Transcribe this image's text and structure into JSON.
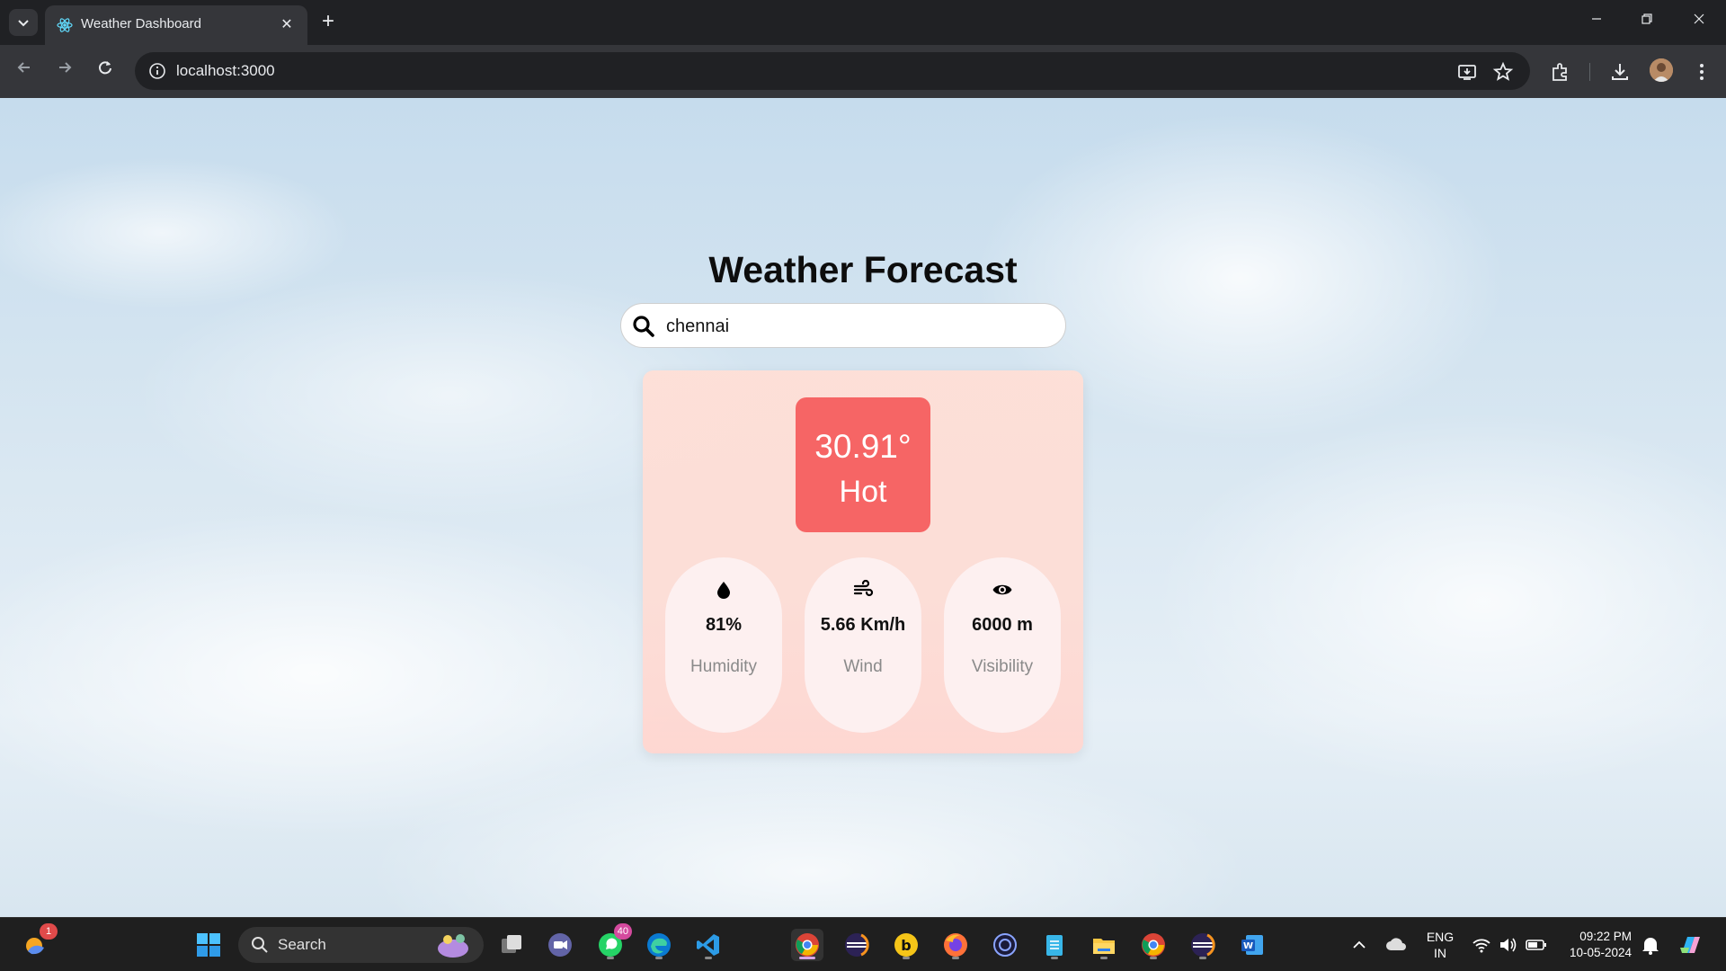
{
  "browser": {
    "tab_title": "Weather Dashboard",
    "tab_close": "✕",
    "new_tab": "+",
    "url": "localhost:3000"
  },
  "page": {
    "title": "Weather Forecast",
    "search": {
      "value": "chennai"
    },
    "weather": {
      "temperature": "30.91°",
      "condition": "Hot",
      "humidity": {
        "value": "81%",
        "label": "Humidity"
      },
      "wind": {
        "value": "5.66 Km/h",
        "label": "Wind"
      },
      "visibility": {
        "value": "6000 m",
        "label": "Visibility"
      }
    }
  },
  "taskbar": {
    "search_label": "Search",
    "notification_count": "1",
    "whatsapp_badge": "40",
    "language": "ENG",
    "region": "IN",
    "time": "09:22 PM",
    "date": "10-05-2024"
  },
  "colors": {
    "temperature_box": "#f66565",
    "card": "#ffdcd4",
    "stat_pill": "#fdf0f0"
  }
}
